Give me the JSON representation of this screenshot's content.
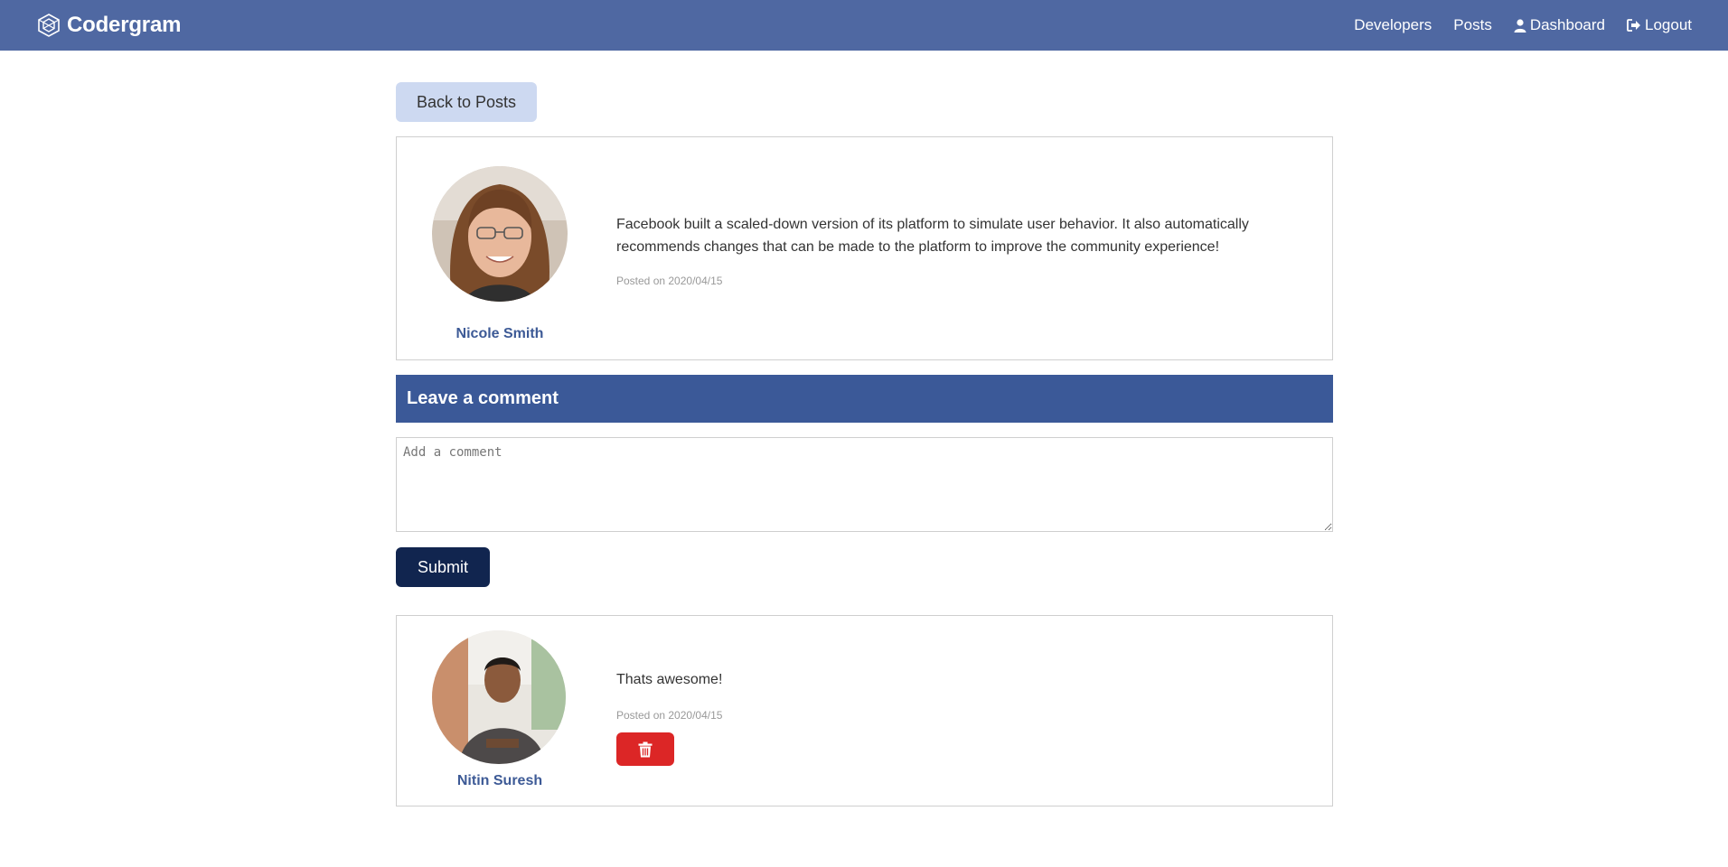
{
  "navbar": {
    "brand": "Codergram",
    "links": {
      "developers": "Developers",
      "posts": "Posts",
      "dashboard": "Dashboard",
      "logout": "Logout"
    },
    "background": "#4f68a2"
  },
  "back_button": {
    "label": "Back to Posts"
  },
  "post": {
    "author": "Nicole Smith",
    "text": "Facebook built a scaled-down version of its platform to simulate user behavior. It also automatically recommends changes that can be made to the platform to improve the community experience!",
    "date": "Posted on 2020/04/15"
  },
  "comment_section": {
    "heading": "Leave a comment",
    "placeholder": "Add a comment",
    "submit_label": "Submit"
  },
  "comments": [
    {
      "author": "Nitin Suresh",
      "text": "Thats awesome!",
      "date": "Posted on 2020/04/15",
      "delete_icon": "trash-icon"
    }
  ],
  "colors": {
    "header": "#3b5998",
    "submit": "#11254f",
    "delete": "#dc2626",
    "author_name": "#3d5a96",
    "back_button": "#cdd9f1"
  }
}
